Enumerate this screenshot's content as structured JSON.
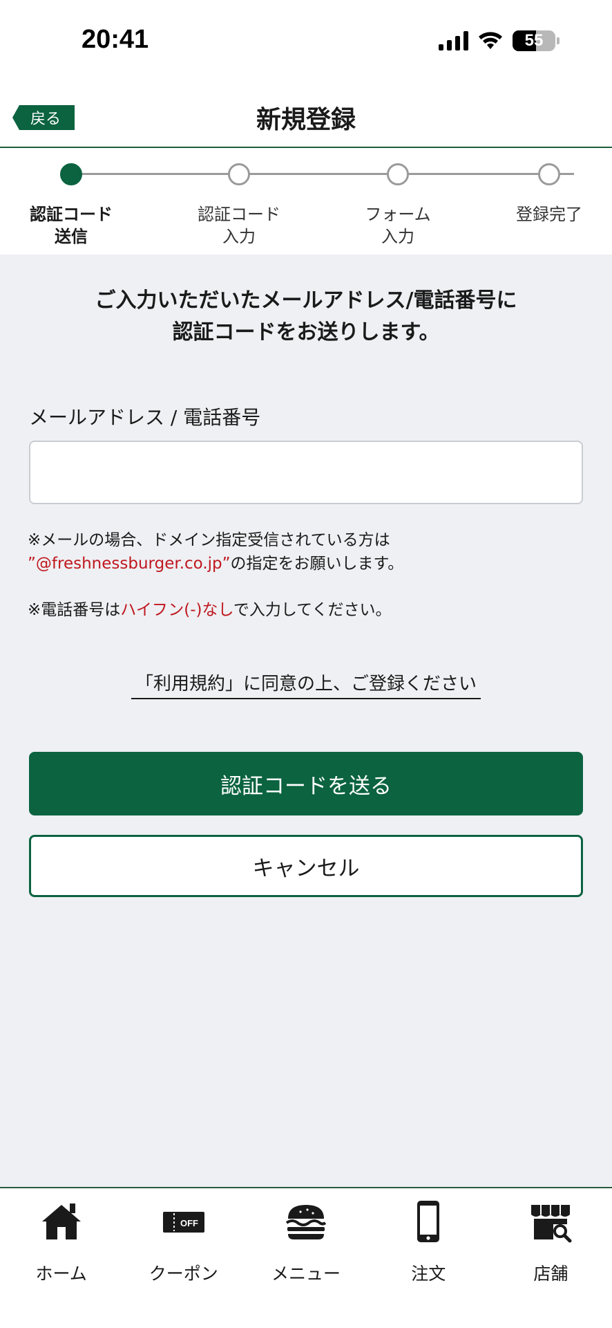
{
  "status": {
    "time": "20:41",
    "battery": "55",
    "battery_level": 0.55
  },
  "header": {
    "back_label": "戻る",
    "title": "新規登録"
  },
  "steps": [
    {
      "label_1": "認証コード",
      "label_2": "送信",
      "active": true
    },
    {
      "label_1": "認証コード",
      "label_2": "入力",
      "active": false
    },
    {
      "label_1": "フォーム",
      "label_2": "入力",
      "active": false
    },
    {
      "label_1": "登録完了",
      "label_2": "",
      "active": false
    }
  ],
  "intro": {
    "line1": "ご入力いただいたメールアドレス/電話番号に",
    "line2": "認証コードをお送りします。"
  },
  "field": {
    "label": "メールアドレス / 電話番号",
    "value": "",
    "placeholder": ""
  },
  "notes": {
    "mail_line1": "※メールの場合、ドメイン指定受信されている方は",
    "mail_domain": "”@freshnessburger.co.jp”",
    "mail_line2_rest": "の指定をお願いします。",
    "phone_prefix": "※電話番号は",
    "phone_highlight": "ハイフン(-)なし",
    "phone_suffix": "で入力してください。"
  },
  "terms_link": "「利用規約」に同意の上、ご登録ください",
  "buttons": {
    "send_code": "認証コードを送る",
    "cancel": "キャンセル"
  },
  "tabbar": [
    {
      "label": "ホーム",
      "icon": "home-icon"
    },
    {
      "label": "クーポン",
      "icon": "coupon-icon"
    },
    {
      "label": "メニュー",
      "icon": "burger-icon"
    },
    {
      "label": "注文",
      "icon": "smartphone-icon"
    },
    {
      "label": "店舗",
      "icon": "store-search-icon"
    }
  ],
  "colors": {
    "brand_green": "#0b6340",
    "accent_red": "#c0171f",
    "background": "#eef0f3"
  }
}
